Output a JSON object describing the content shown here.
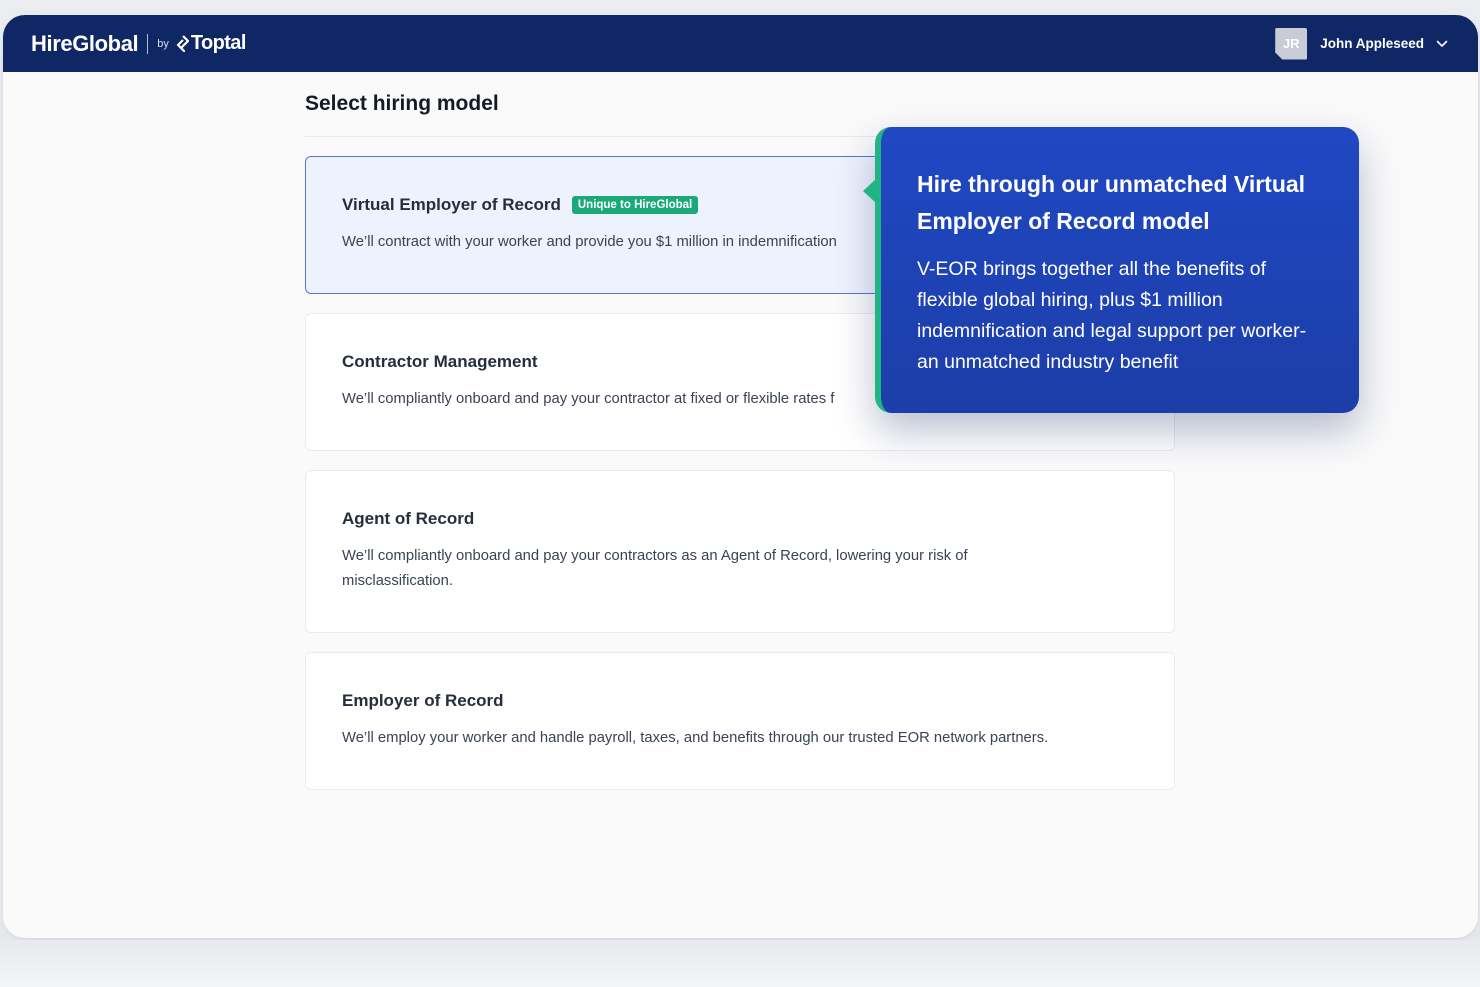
{
  "brand": {
    "name": "HireGlobal",
    "by": "by",
    "partner": "Toptal"
  },
  "user": {
    "initials": "JR",
    "name": "John Appleseed",
    "chevron_icon": "chevron-down-icon"
  },
  "page": {
    "title": "Select hiring model"
  },
  "options": [
    {
      "title": "Virtual Employer of Record",
      "badge": "Unique to HireGlobal",
      "description": "We’ll contract with your worker and provide you $1 million in indemnification",
      "selected": true
    },
    {
      "title": "Contractor Management",
      "description": "We’ll compliantly onboard and pay your contractor at fixed or flexible rates f"
    },
    {
      "title": "Agent of Record",
      "description": "We’ll compliantly onboard and pay your contractors as an Agent of Record, lowering your risk of misclassification."
    },
    {
      "title": "Employer of Record",
      "description": "We’ll employ your worker and handle payroll, taxes, and benefits through our trusted EOR network partners."
    }
  ],
  "tooltip": {
    "title": "Hire through our unmatched Virtual Employer of Record model",
    "body": "V-EOR brings together all the benefits of flexible global hiring, plus $1 million indemnification and legal support per worker-an unmatched industry benefit"
  },
  "colors": {
    "topbar": "#0f2765",
    "accent": "#2048c4",
    "badge": "#1ba97a",
    "tooltip_edge": "#22b584"
  }
}
